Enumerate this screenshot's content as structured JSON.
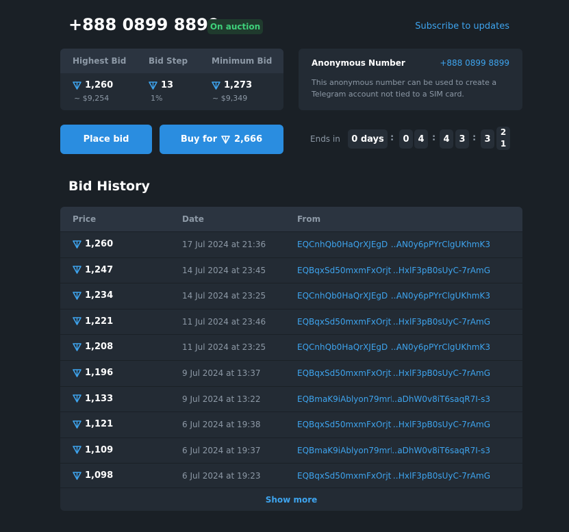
{
  "header": {
    "title": "+888 0899 8899",
    "status": "On auction",
    "subscribe": "Subscribe to updates"
  },
  "stats": [
    {
      "label": "Highest Bid",
      "value": "1,260",
      "sub": "~ $9,254"
    },
    {
      "label": "Bid Step",
      "value": "13",
      "sub": "1%"
    },
    {
      "label": "Minimum Bid",
      "value": "1,273",
      "sub": "~ $9,349"
    }
  ],
  "anon": {
    "title": "Anonymous Number",
    "number": "+888 0899 8899",
    "description": "This anonymous number can be used to create a Telegram account not tied to a SIM card."
  },
  "actions": {
    "place_bid": "Place bid",
    "buy_prefix": "Buy for",
    "buy_price": "2,666"
  },
  "countdown": {
    "label": "Ends in",
    "days": "0 days",
    "h1": "0",
    "h2": "4",
    "m1": "4",
    "m2": "3",
    "s1": "3",
    "s2_top": "2",
    "s2_bottom": "1",
    "sep": ":"
  },
  "history": {
    "title": "Bid History",
    "columns": {
      "price": "Price",
      "date": "Date",
      "from": "From"
    },
    "rows": [
      {
        "price": "1,260",
        "date": "17 Jul 2024 at 21:36",
        "from_a": "EQCnhQb0HaQrXJEgD",
        "from_b": "AN0y6pPYrClgUKhmK3"
      },
      {
        "price": "1,247",
        "date": "14 Jul 2024 at 23:45",
        "from_a": "EQBqxSd50mxmFxOrjt",
        "from_b": "HxlF3pB0sUyC-7rAmG"
      },
      {
        "price": "1,234",
        "date": "14 Jul 2024 at 23:25",
        "from_a": "EQCnhQb0HaQrXJEgD",
        "from_b": "AN0y6pPYrClgUKhmK3"
      },
      {
        "price": "1,221",
        "date": "11 Jul 2024 at 23:46",
        "from_a": "EQBqxSd50mxmFxOrjt",
        "from_b": "HxlF3pB0sUyC-7rAmG"
      },
      {
        "price": "1,208",
        "date": "11 Jul 2024 at 23:25",
        "from_a": "EQCnhQb0HaQrXJEgD",
        "from_b": "AN0y6pPYrClgUKhmK3"
      },
      {
        "price": "1,196",
        "date": "9 Jul 2024 at 13:37",
        "from_a": "EQBqxSd50mxmFxOrjt",
        "from_b": "HxlF3pB0sUyC-7rAmG"
      },
      {
        "price": "1,133",
        "date": "9 Jul 2024 at 13:22",
        "from_a": "EQBmaK9iAblyon79mrI",
        "from_b": "aDhW0v8iT6saqR7I-s3"
      },
      {
        "price": "1,121",
        "date": "6 Jul 2024 at 19:38",
        "from_a": "EQBqxSd50mxmFxOrjt",
        "from_b": "HxlF3pB0sUyC-7rAmG"
      },
      {
        "price": "1,109",
        "date": "6 Jul 2024 at 19:37",
        "from_a": "EQBmaK9iAblyon79mrI",
        "from_b": "aDhW0v8iT6saqR7I-s3"
      },
      {
        "price": "1,098",
        "date": "6 Jul 2024 at 19:23",
        "from_a": "EQBqxSd50mxmFxOrjt",
        "from_b": "HxlF3pB0sUyC-7rAmG"
      }
    ],
    "show_more": "Show more",
    "ellipsis": "..."
  },
  "colors": {
    "background": "#1a2026",
    "card": "#232b34",
    "accent": "#2a8de0",
    "link": "#3ea4ee",
    "status_green": "#3ed07a",
    "ton_icon": "#3ea4ee"
  },
  "icons": {
    "currency": "ton-diamond-icon"
  }
}
